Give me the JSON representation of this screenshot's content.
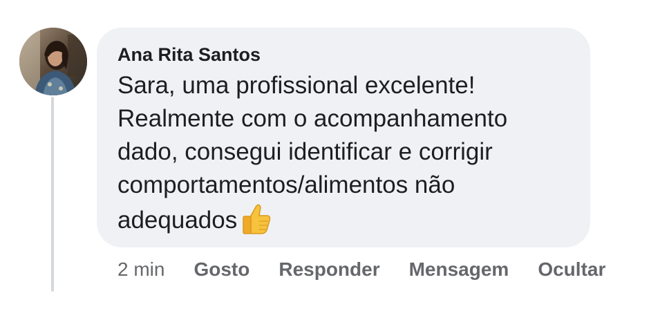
{
  "comment": {
    "author": "Ana Rita Santos",
    "lines": [
      "Sara, uma profissional excelente!",
      "Realmente com o acompanhamento",
      "dado, consegui identificar e corrigir",
      "comportamentos/alimentos não",
      "adequados"
    ],
    "trailing_emoji": "thumbs-up-icon",
    "timestamp": "2 min",
    "actions": {
      "like": "Gosto",
      "reply": "Responder",
      "message": "Mensagem",
      "hide": "Ocultar"
    }
  },
  "colors": {
    "bubble_background": "#eff1f4",
    "text_primary": "#1c1e21",
    "text_secondary": "#65676b",
    "thread_line": "#d4d7db"
  }
}
